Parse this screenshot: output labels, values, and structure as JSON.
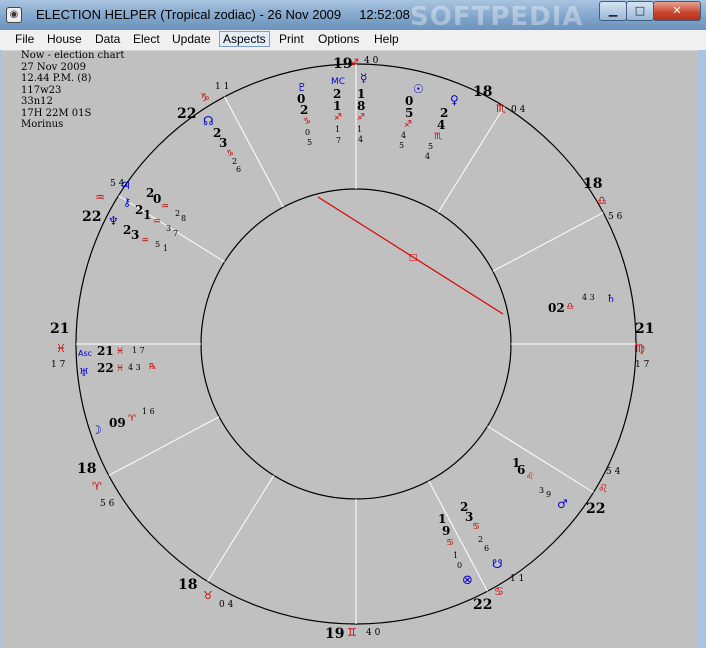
{
  "window": {
    "title": "ELECTION HELPER (Tropical zodiac) - 26 Nov 2009     12:52:08",
    "watermark": "SOFTPEDIA",
    "icon": "app-globe-icon",
    "controls": {
      "minimize": "minimize-icon",
      "maximize": "maximize-icon",
      "close": "close-icon"
    }
  },
  "menu": [
    "File",
    "House",
    "Data",
    "Elect",
    "Update",
    "Aspects",
    "Print",
    "Options",
    "Help"
  ],
  "menu_active": "Aspects",
  "chart_info": [
    "Now - election chart",
    "27 Nov 2009",
    "12.44 P.M. (8)",
    "117w23",
    "33n12",
    "17H  22M  01S",
    "Morinus"
  ],
  "colors": {
    "planet": "#0000cc",
    "sign": "#cc0000",
    "aspect": "#dd0000",
    "text": "#000000",
    "line": "#ffffff",
    "circle": "#000000"
  },
  "wheel": {
    "cusps": [
      {
        "house": 1,
        "deg": "21",
        "sign": "pisces",
        "glyph": "♓",
        "min": "1 7"
      },
      {
        "house": 2,
        "deg": "18",
        "sign": "aries",
        "glyph": "♈",
        "min": "5 6"
      },
      {
        "house": 3,
        "deg": "18",
        "sign": "taurus",
        "glyph": "♉",
        "min": "0 4"
      },
      {
        "house": 4,
        "deg": "19",
        "sign": "gemini",
        "glyph": "♊",
        "min": "4 0"
      },
      {
        "house": 5,
        "deg": "22",
        "sign": "cancer",
        "glyph": "♋",
        "min": "1 1"
      },
      {
        "house": 6,
        "deg": "22",
        "sign": "leo",
        "glyph": "♌",
        "min": "5 4"
      },
      {
        "house": 7,
        "deg": "21",
        "sign": "virgo",
        "glyph": "♍",
        "min": "1 7"
      },
      {
        "house": 8,
        "deg": "18",
        "sign": "libra",
        "glyph": "♎",
        "min": "5 6"
      },
      {
        "house": 9,
        "deg": "18",
        "sign": "scorpio",
        "glyph": "♏",
        "min": "0 4"
      },
      {
        "house": 10,
        "deg": "19",
        "sign": "sagittarius",
        "glyph": "♐",
        "min": "4 0"
      },
      {
        "house": 11,
        "deg": "22",
        "sign": "capricorn",
        "glyph": "♑",
        "min": "1 1"
      },
      {
        "house": 12,
        "deg": "22",
        "sign": "aquarius",
        "glyph": "♒",
        "min": "5 4"
      }
    ],
    "planets": [
      {
        "name": "pluto",
        "glyph": "♇",
        "deg": "02",
        "sign": "♑",
        "min": "05"
      },
      {
        "name": "midheaven",
        "glyph": "MC",
        "deg": "21",
        "sign": "♐",
        "min": "17"
      },
      {
        "name": "mercury",
        "glyph": "☿",
        "deg": "18",
        "sign": "♐",
        "min": "14"
      },
      {
        "name": "sun",
        "glyph": "☉",
        "deg": "05",
        "sign": "♐",
        "min": "45"
      },
      {
        "name": "venus",
        "glyph": "♀",
        "deg": "24",
        "sign": "♏",
        "min": "54"
      },
      {
        "name": "north-node",
        "glyph": "☊",
        "deg": "23",
        "sign": "♑",
        "min": "26"
      },
      {
        "name": "jupiter",
        "glyph": "♃",
        "deg": "20",
        "sign": "♒",
        "min": "28"
      },
      {
        "name": "chiron",
        "glyph": "⚷",
        "deg": "21",
        "sign": "♒",
        "min": "37"
      },
      {
        "name": "neptune",
        "glyph": "♆",
        "deg": "23",
        "sign": "♒",
        "min": "51"
      },
      {
        "name": "ascendant",
        "glyph": "Asc",
        "deg": "21",
        "sign": "♓",
        "min": "17"
      },
      {
        "name": "uranus",
        "glyph": "♅",
        "deg": "22",
        "sign": "♓",
        "min": "43",
        "retro": "℞"
      },
      {
        "name": "moon",
        "glyph": "☽",
        "deg": "09",
        "sign": "♈",
        "min": "16"
      },
      {
        "name": "saturn",
        "glyph": "♄",
        "deg": "02",
        "sign": "♎",
        "min": "43"
      },
      {
        "name": "mars",
        "glyph": "♂",
        "deg": "16",
        "sign": "♌",
        "min": "39"
      },
      {
        "name": "south-node",
        "glyph": "☋",
        "deg": "23",
        "sign": "♋",
        "min": "26"
      },
      {
        "name": "part-of-fortune",
        "glyph": "⊗",
        "deg": "19",
        "sign": "♋",
        "min": "10"
      }
    ],
    "aspect": {
      "from": "jupiter",
      "to": "saturn",
      "type": "square",
      "glyph": "□"
    }
  }
}
